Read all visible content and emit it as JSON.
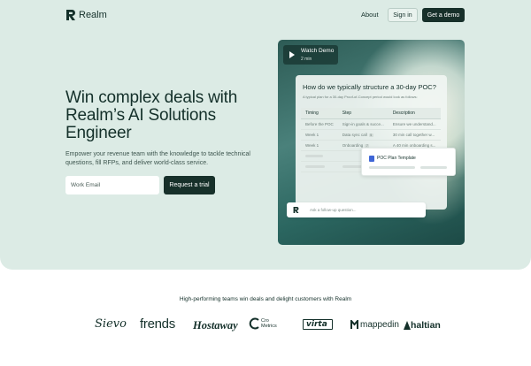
{
  "nav": {
    "brand": "Realm",
    "about": "About",
    "sign_in": "Sign in",
    "get_demo": "Get a demo"
  },
  "hero": {
    "headline": "Win complex deals with Realm’s AI Solutions Engineer",
    "subtext": "Empower your revenue team with the knowledge to tackle technical questions, fill RFPs, and deliver world-class service.",
    "email_placeholder": "Work Email",
    "cta": "Request a trial"
  },
  "demo": {
    "watch_title": "Watch Demo",
    "watch_duration": "2 min",
    "question": "How do we typically structure a 30-day POC?",
    "intro": "A typical plan for a 30-day Proof-of-Concept period would look as follows:",
    "table": {
      "headers": [
        "Timing",
        "Step",
        "Description"
      ],
      "rows": [
        [
          "Before the POC",
          "Sign-in goals & succe...",
          "Ensure we understand..."
        ],
        [
          "Week 1",
          "Data sync call",
          "30 min call together w..."
        ],
        [
          "Week 1",
          "Onboarding",
          "A 40 min onboarding s..."
        ]
      ],
      "badges": [
        "5",
        "7"
      ]
    },
    "poc_card": "POC Plan Template",
    "followup_placeholder": "Ask a follow-up question..."
  },
  "customers": {
    "tagline": "High-performing teams win deals and delight customers with Realm",
    "logos": [
      "Sievo",
      "frends",
      "Hostaway",
      "Cro Metrics",
      "virta",
      "mappedin",
      "haltian"
    ]
  },
  "colors": {
    "hero_bg": "#dcebe5",
    "primary": "#17302a",
    "text": "#14302a",
    "accent_doc": "#3f66d6"
  }
}
